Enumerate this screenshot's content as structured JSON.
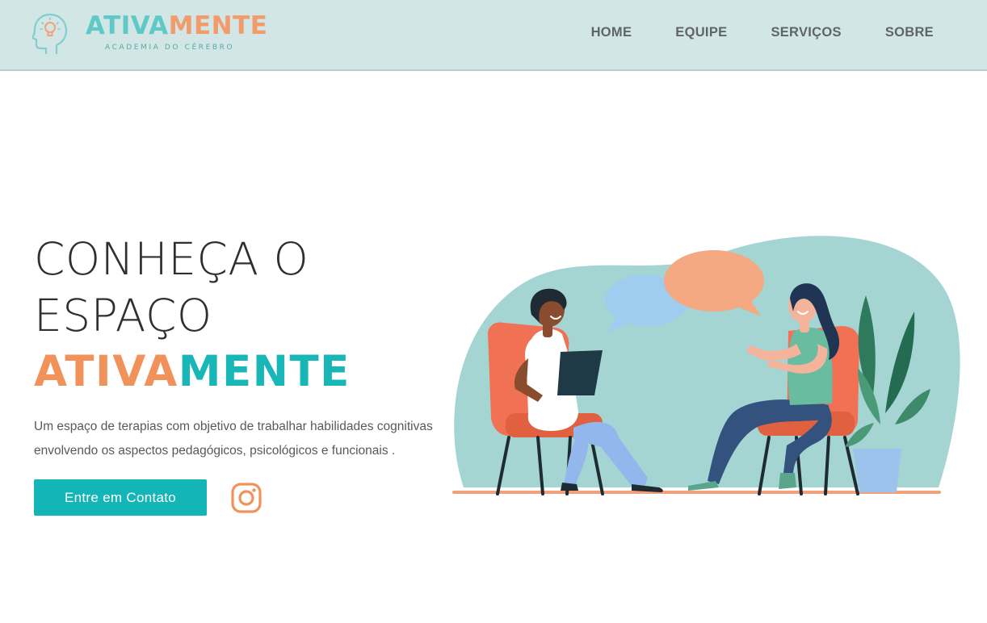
{
  "header": {
    "logo": {
      "word_part1": "ATIVA",
      "word_part2": "MENTE",
      "tagline": "ACADEMIA DO CÉREBRO",
      "icon": "head-with-lightbulb-icon"
    },
    "nav": [
      {
        "label": "HOME"
      },
      {
        "label": "EQUIPE"
      },
      {
        "label": "SERVIÇOS"
      },
      {
        "label": "SOBRE"
      }
    ]
  },
  "hero": {
    "title_line1": "CONHEÇA O",
    "title_line2": "ESPAÇO",
    "brand_part1": "ATIVA",
    "brand_part2": "MENTE",
    "description": "Um espaço de terapias com objetivo de trabalhar habilidades cognitivas envolvendo os aspectos pedagógicos, psicológicos e funcionais .",
    "cta_label": "Entre em Contato",
    "social_icon": "instagram-icon",
    "illustration": "two-women-conversation-illustration"
  },
  "colors": {
    "header_bg": "#d3e6e6",
    "teal": "#19b6b8",
    "orange": "#f2925b",
    "text_dark": "#2f2f2f",
    "nav_text": "#5f6566"
  }
}
